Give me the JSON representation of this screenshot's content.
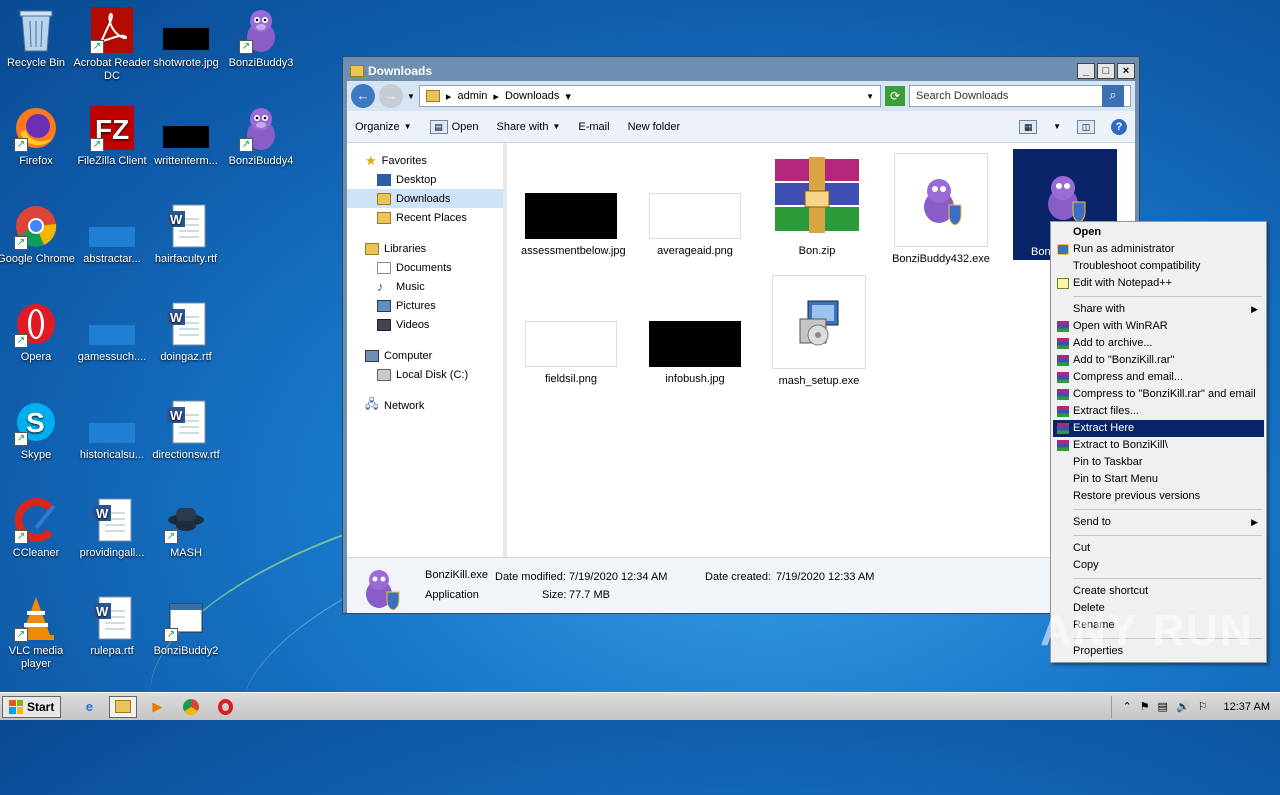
{
  "desktop": {
    "icons": [
      {
        "label": "Recycle Bin"
      },
      {
        "label": "Acrobat Reader DC"
      },
      {
        "label": "shotwrote.jpg"
      },
      {
        "label": "BonziBuddy3"
      },
      {
        "label": "Firefox"
      },
      {
        "label": "FileZilla Client"
      },
      {
        "label": "writtenterm..."
      },
      {
        "label": "BonziBuddy4"
      },
      {
        "label": "Google Chrome"
      },
      {
        "label": "abstractar..."
      },
      {
        "label": "hairfaculty.rtf"
      },
      {
        "label": "Opera"
      },
      {
        "label": "gamessuch...."
      },
      {
        "label": "doingaz.rtf"
      },
      {
        "label": "Skype"
      },
      {
        "label": "historicalsu..."
      },
      {
        "label": "directionsw.rtf"
      },
      {
        "label": "CCleaner"
      },
      {
        "label": "providingall..."
      },
      {
        "label": "MASH"
      },
      {
        "label": "VLC media player"
      },
      {
        "label": "rulepa.rtf"
      },
      {
        "label": "BonziBuddy2"
      }
    ]
  },
  "window": {
    "title": "Downloads",
    "breadcrumb": [
      "admin",
      "Downloads"
    ],
    "search_placeholder": "Search Downloads",
    "toolbar": {
      "organize": "Organize",
      "open": "Open",
      "share_with": "Share with",
      "email": "E-mail",
      "new_folder": "New folder"
    },
    "nav": {
      "favorites": "Favorites",
      "desktop": "Desktop",
      "downloads": "Downloads",
      "recent": "Recent Places",
      "libraries": "Libraries",
      "documents": "Documents",
      "music": "Music",
      "pictures": "Pictures",
      "videos": "Videos",
      "computer": "Computer",
      "local_disk": "Local Disk (C:)",
      "network": "Network"
    },
    "files": [
      {
        "name": "assessmentbelow.jpg"
      },
      {
        "name": "averageaid.png"
      },
      {
        "name": "Bon.zip"
      },
      {
        "name": "BonziBuddy432.exe"
      },
      {
        "name": "Bon"
      },
      {
        "name": "fieldsil.png"
      },
      {
        "name": "infobush.jpg"
      },
      {
        "name": "mash_setup.exe"
      }
    ],
    "status": {
      "name": "BonziKill.exe",
      "modified_label": "Date modified:",
      "modified": "7/19/2020 12:34 AM",
      "created_label": "Date created:",
      "created": "7/19/2020 12:33 AM",
      "type": "Application",
      "size_label": "Size:",
      "size": "77.7 MB"
    }
  },
  "context_menu": {
    "items": [
      {
        "label": "Open"
      },
      {
        "label": "Run as administrator"
      },
      {
        "label": "Troubleshoot compatibility"
      },
      {
        "label": "Edit with Notepad++"
      },
      {
        "label": "Share with"
      },
      {
        "label": "Open with WinRAR"
      },
      {
        "label": "Add to archive..."
      },
      {
        "label": "Add to \"BonziKill.rar\""
      },
      {
        "label": "Compress and email..."
      },
      {
        "label": "Compress to \"BonziKill.rar\" and email"
      },
      {
        "label": "Extract files..."
      },
      {
        "label": "Extract Here"
      },
      {
        "label": "Extract to BonziKill\\"
      },
      {
        "label": "Pin to Taskbar"
      },
      {
        "label": "Pin to Start Menu"
      },
      {
        "label": "Restore previous versions"
      },
      {
        "label": "Send to"
      },
      {
        "label": "Cut"
      },
      {
        "label": "Copy"
      },
      {
        "label": "Create shortcut"
      },
      {
        "label": "Delete"
      },
      {
        "label": "Rename"
      },
      {
        "label": "Properties"
      }
    ]
  },
  "taskbar": {
    "start": "Start",
    "clock": "12:37 AM"
  },
  "watermark": "ANY RUN"
}
